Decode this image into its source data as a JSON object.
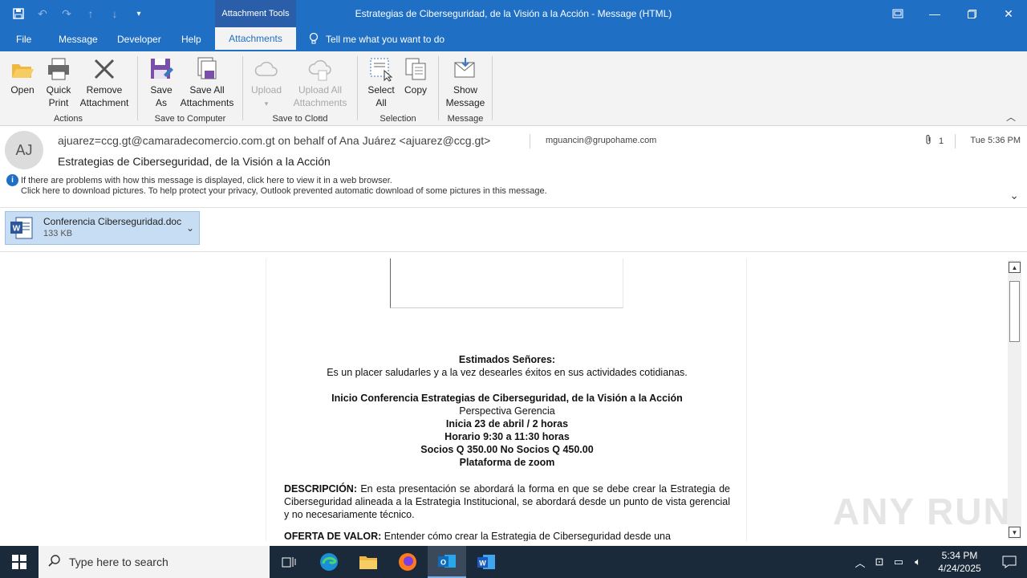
{
  "window": {
    "context_tab_header": "Attachment Tools",
    "title": "Estrategias de Ciberseguridad, de la Visión a la Acción  -  Message (HTML)"
  },
  "tabs": [
    {
      "label": "File"
    },
    {
      "label": "Message"
    },
    {
      "label": "Developer"
    },
    {
      "label": "Help"
    },
    {
      "label": "Attachments",
      "active": true
    }
  ],
  "tell_me": "Tell me what you want to do",
  "ribbon": {
    "groups": {
      "actions": "Actions",
      "save_to_computer": "Save to Computer",
      "save_to_cloud": "Save to Cloud",
      "selection": "Selection",
      "message": "Message"
    },
    "buttons": {
      "open": "Open",
      "quick_print_1": "Quick",
      "quick_print_2": "Print",
      "remove_1": "Remove",
      "remove_2": "Attachment",
      "save_as_1": "Save",
      "save_as_2": "As",
      "save_all_1": "Save All",
      "save_all_2": "Attachments",
      "upload": "Upload",
      "upload_all_1": "Upload All",
      "upload_all_2": "Attachments",
      "select_all_1": "Select",
      "select_all_2": "All",
      "copy": "Copy",
      "show_message_1": "Show",
      "show_message_2": "Message"
    }
  },
  "header": {
    "avatar_initials": "AJ",
    "from": "ajuarez=ccg.gt@camaradecomercio.com.gt on behalf of Ana Juárez <ajuarez@ccg.gt>",
    "to": "mguancin@grupohame.com",
    "attachment_count": "1",
    "time": "Tue 5:36 PM",
    "subject": "Estrategias de Ciberseguridad, de la Visión a la Acción",
    "info_line_1": "If there are problems with how this message is displayed, click here to view it in a web browser.",
    "info_line_2": "Click here to download pictures. To help protect your privacy, Outlook prevented automatic download of some pictures in this message."
  },
  "attachment": {
    "name": "Conferencia Ciberseguridad.doc",
    "size": "133 KB"
  },
  "message": {
    "greeting": "Estimados Señores:",
    "intro": "Es un placer saludarles y a la vez desearles éxitos en sus actividades cotidianas.",
    "event_title": "Inicio Conferencia  Estrategias  de Ciberseguridad,  de la Visión a la Acción",
    "perspective": "Perspectiva Gerencia",
    "start": "Inicia 23 de abril / 2 horas",
    "schedule": "Horario  9:30  a 11:30  horas",
    "prices": "Socios Q 350.00 No Socios Q 450.00",
    "platform": "Plataforma de zoom",
    "desc_label": "DESCRIPCIÓN:",
    "desc_text": " En esta presentación se abordará la forma en que se debe crear la Estrategia de Ciberseguridad alineada a la Estrategia Institucional, se abordará desde un punto de vista gerencial y no necesariamente técnico.",
    "value_label": "OFERTA  DE  VALOR:",
    "value_text": " Entender  cómo  crear  la  Estrategia  de  Ciberseguridad  desde  una"
  },
  "watermark": "ANY RUN",
  "taskbar": {
    "search_placeholder": "Type here to search",
    "clock_time": "5:34 PM",
    "clock_date": "4/24/2025"
  },
  "icons": [
    "save-icon",
    "undo-icon",
    "redo-icon",
    "up-icon",
    "down-icon",
    "customize-icon",
    "restore-icon",
    "minimize-icon",
    "maximize-icon",
    "close-icon",
    "lightbulb-icon",
    "folder-open-icon",
    "printer-icon",
    "x-remove-icon",
    "save-as-icon",
    "save-all-icon",
    "cloud-upload-icon",
    "cloud-upload-all-icon",
    "select-all-icon",
    "copy-icon",
    "show-message-icon",
    "paperclip-icon",
    "info-icon",
    "word-doc-icon",
    "windows-start-icon",
    "search-icon",
    "task-view-icon",
    "edge-icon",
    "file-explorer-icon",
    "firefox-icon",
    "outlook-icon",
    "word-icon",
    "notification-icon"
  ],
  "colors": {
    "accent": "#1f6fc5",
    "attachment_bg": "#c7ddf3",
    "taskbar": "#1b2a3a"
  }
}
